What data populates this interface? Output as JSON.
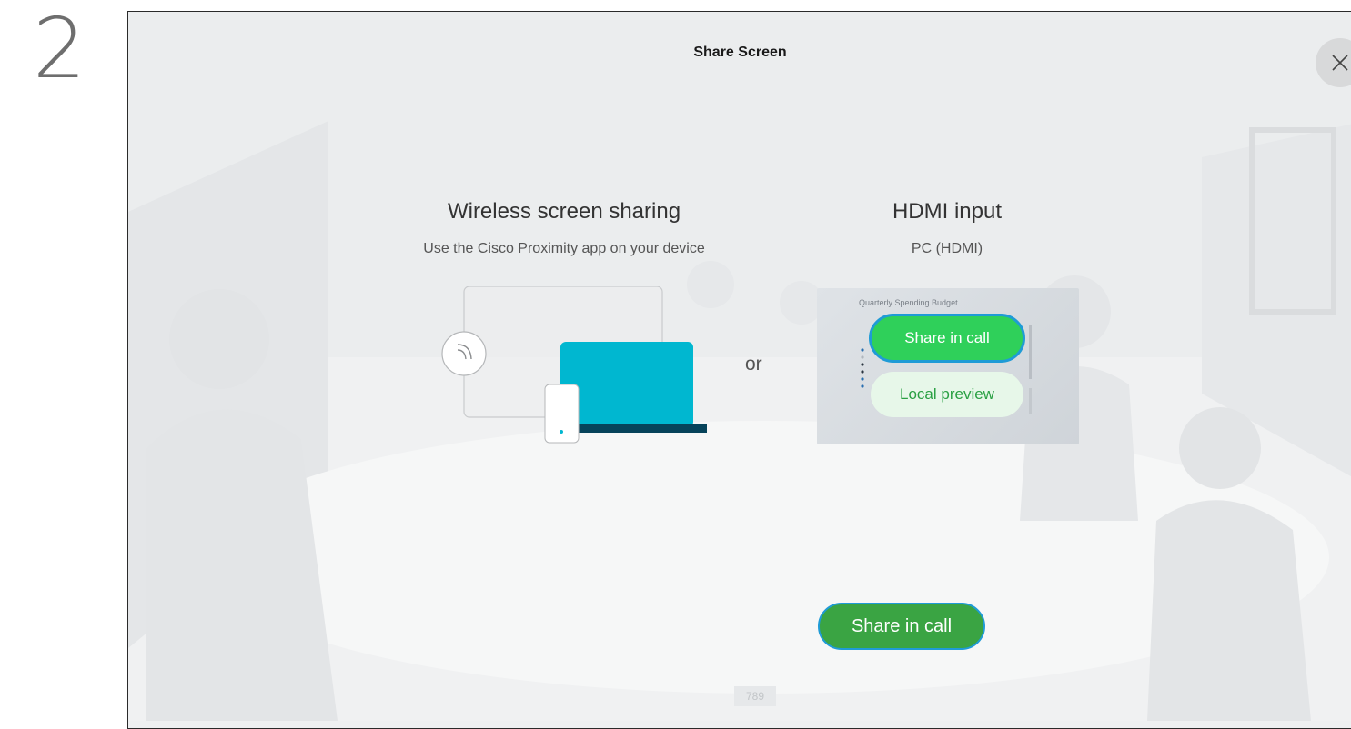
{
  "step": {
    "number": "2"
  },
  "dialog": {
    "title": "Share Screen",
    "close_icon": "close-icon",
    "wireless": {
      "title": "Wireless screen sharing",
      "subtitle": "Use the Cisco Proximity app on your device",
      "icon": "proximity-signal-icon"
    },
    "separator": "or",
    "hdmi": {
      "title": "HDMI input",
      "subtitle": "PC (HDMI)",
      "preview_doc_title": "Quarterly Spending Budget",
      "share_in_call_label": "Share in call",
      "local_preview_label": "Local preview"
    },
    "primary_action": {
      "label": "Share in call"
    },
    "bottom_label": "789"
  },
  "colors": {
    "share_green": "#2fd05a",
    "primary_green": "#3aa443",
    "focus_blue": "#1f9bd6",
    "laptop_cyan": "#00b7d0",
    "laptop_base": "#06435a"
  }
}
